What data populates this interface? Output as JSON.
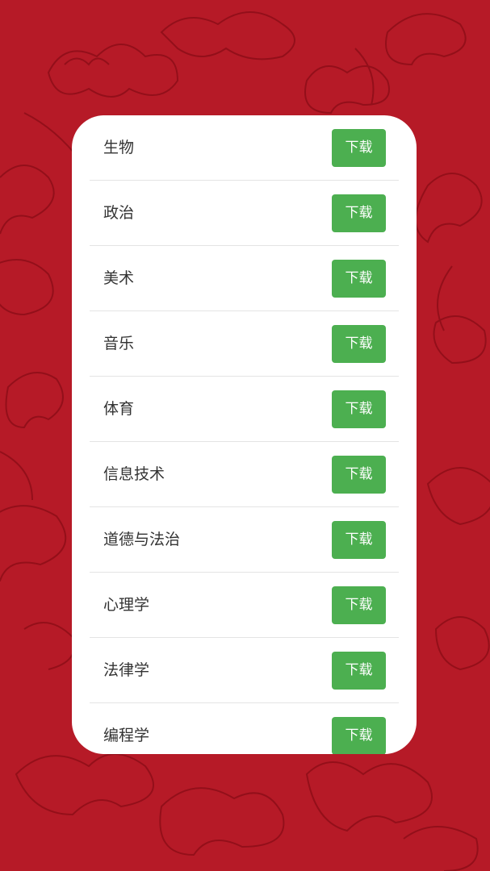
{
  "colors": {
    "background": "#b61a27",
    "pattern": "#8e0e18",
    "card": "#ffffff",
    "button": "#4caf50",
    "button_text": "#ffffff",
    "label_text": "#333333"
  },
  "background_icon": "cloud-pattern",
  "subjects": [
    {
      "label": "生物",
      "button": "下载"
    },
    {
      "label": "政治",
      "button": "下载"
    },
    {
      "label": "美术",
      "button": "下载"
    },
    {
      "label": "音乐",
      "button": "下载"
    },
    {
      "label": "体育",
      "button": "下载"
    },
    {
      "label": "信息技术",
      "button": "下载"
    },
    {
      "label": "道德与法治",
      "button": "下载"
    },
    {
      "label": "心理学",
      "button": "下载"
    },
    {
      "label": "法律学",
      "button": "下载"
    },
    {
      "label": "编程学",
      "button": "下载"
    }
  ]
}
